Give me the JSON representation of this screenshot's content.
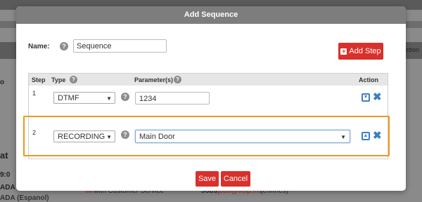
{
  "modal": {
    "title": "Add Sequence",
    "name_label": "Name:",
    "name_value": "Sequence",
    "add_step_label": "Add Step",
    "save_label": "Save",
    "cancel_label": "Cancel"
  },
  "table": {
    "headers": {
      "step": "Step",
      "type": "Type",
      "parameters": "Parameter(s)",
      "action": "Action"
    },
    "rows": [
      {
        "step": "1",
        "type": "DTMF",
        "parameter": "1234"
      },
      {
        "step": "2",
        "type": "RECORDING",
        "parameter": "Main Door"
      }
    ]
  },
  "help_glyph": "?",
  "background": {
    "right_label": "Action",
    "left_fragment": "o",
    "frag_at": "at",
    "frag_time": "9:0",
    "frag_ada": "ADA",
    "frag_ada_es": "ADA (Espanol)",
    "footer_red": "IM",
    "footer_text": "with Customer Service",
    "jobs_label": "Jobs:",
    "jobs_link": "jobs@voip.ms",
    "jobs_lang": "(en/fr/es)"
  },
  "colors": {
    "accent_red": "#d9302b",
    "highlight_orange": "#f0961e",
    "action_blue": "#3d7fc1"
  }
}
